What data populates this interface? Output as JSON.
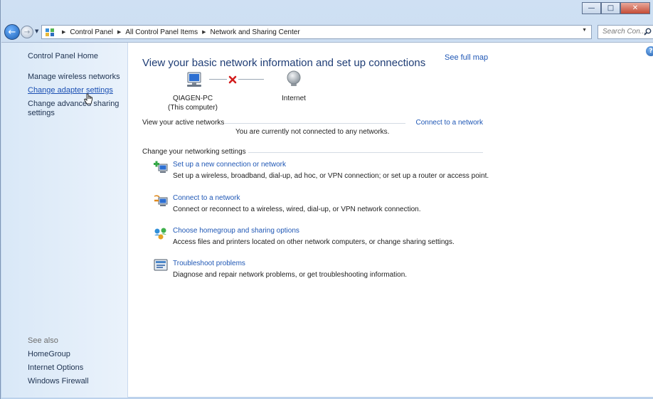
{
  "window": {
    "minimize_icon": "minimize-icon",
    "maximize_icon": "maximize-icon",
    "close_icon": "close-icon"
  },
  "address_bar": {
    "breadcrumbs": [
      "Control Panel",
      "All Control Panel Items",
      "Network and Sharing Center"
    ],
    "search_placeholder": "Search Con..."
  },
  "sidebar": {
    "home": "Control Panel Home",
    "links": [
      "Manage wireless networks",
      "Change adapter settings",
      "Change advanced sharing",
      "settings"
    ],
    "see_also_label": "See also",
    "see_also": [
      "HomeGroup",
      "Internet Options",
      "Windows Firewall"
    ]
  },
  "main": {
    "title": "View your basic network information and set up connections",
    "see_full_map": "See full map",
    "map": {
      "computer_name": "QIAGEN-PC",
      "computer_sub": "(This computer)",
      "internet": "Internet"
    },
    "active_networks_label": "View your active networks",
    "connect_link": "Connect to a network",
    "not_connected": "You are currently not connected to any networks.",
    "change_settings_label": "Change your networking settings",
    "tasks": [
      {
        "title": "Set up a new connection or network",
        "desc": "Set up a wireless, broadband, dial-up, ad hoc, or VPN connection; or set up a router or access point.",
        "icon": "new-connection-icon"
      },
      {
        "title": "Connect to a network",
        "desc": "Connect or reconnect to a wireless, wired, dial-up, or VPN network connection.",
        "icon": "connect-network-icon"
      },
      {
        "title": "Choose homegroup and sharing options",
        "desc": "Access files and printers located on other network computers, or change sharing settings.",
        "icon": "homegroup-icon"
      },
      {
        "title": "Troubleshoot problems",
        "desc": "Diagnose and repair network problems, or get troubleshooting information.",
        "icon": "troubleshoot-icon"
      }
    ]
  },
  "colors": {
    "link": "#1f57b5",
    "title": "#1f3d75",
    "sidebar_bg": "#dfeaf7"
  }
}
